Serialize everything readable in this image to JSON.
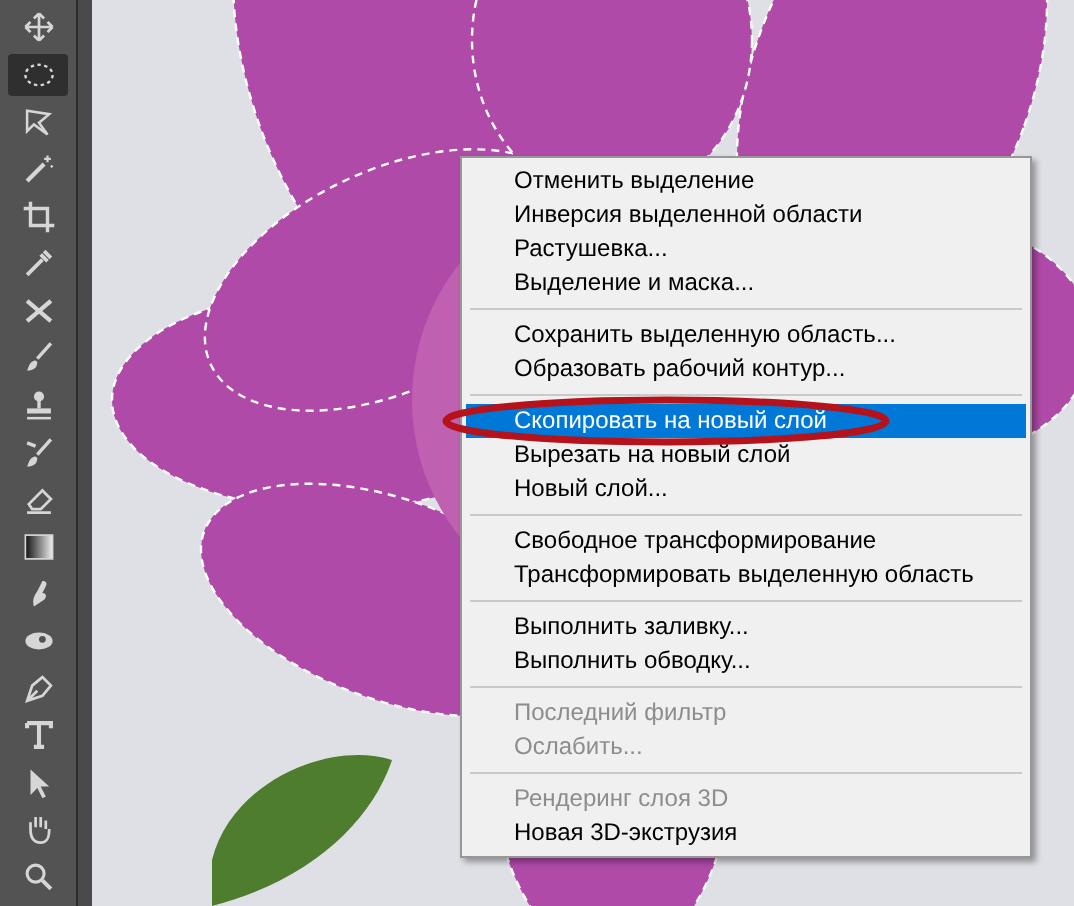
{
  "toolbar": {
    "tools": [
      {
        "selected": false
      },
      {
        "selected": true
      },
      {
        "selected": false
      },
      {
        "selected": false
      },
      {
        "selected": false
      },
      {
        "selected": false
      },
      {
        "selected": false
      },
      {
        "selected": false
      },
      {
        "selected": false
      },
      {
        "selected": false
      },
      {
        "selected": false
      },
      {
        "selected": false
      },
      {
        "selected": false
      },
      {
        "selected": false
      },
      {
        "selected": false
      },
      {
        "selected": false
      },
      {
        "selected": false
      },
      {
        "selected": false
      },
      {
        "selected": false
      }
    ]
  },
  "context_menu": {
    "groups": [
      {
        "items": [
          {
            "label": "Отменить выделение",
            "disabled": false,
            "selected": false
          },
          {
            "label": "Инверсия выделенной области",
            "disabled": false,
            "selected": false
          },
          {
            "label": "Растушевка...",
            "disabled": false,
            "selected": false
          },
          {
            "label": "Выделение и маска...",
            "disabled": false,
            "selected": false
          }
        ]
      },
      {
        "items": [
          {
            "label": "Сохранить выделенную область...",
            "disabled": false,
            "selected": false
          },
          {
            "label": "Образовать рабочий контур...",
            "disabled": false,
            "selected": false
          }
        ]
      },
      {
        "items": [
          {
            "label": "Скопировать на новый слой",
            "disabled": false,
            "selected": true
          },
          {
            "label": "Вырезать на новый слой",
            "disabled": false,
            "selected": false
          },
          {
            "label": "Новый слой...",
            "disabled": false,
            "selected": false
          }
        ]
      },
      {
        "items": [
          {
            "label": "Свободное трансформирование",
            "disabled": false,
            "selected": false
          },
          {
            "label": "Трансформировать выделенную область",
            "disabled": false,
            "selected": false
          }
        ]
      },
      {
        "items": [
          {
            "label": "Выполнить заливку...",
            "disabled": false,
            "selected": false
          },
          {
            "label": "Выполнить обводку...",
            "disabled": false,
            "selected": false
          }
        ]
      },
      {
        "items": [
          {
            "label": "Последний фильтр",
            "disabled": true,
            "selected": false
          },
          {
            "label": "Ослабить...",
            "disabled": true,
            "selected": false
          }
        ]
      },
      {
        "items": [
          {
            "label": "Рендеринг слоя 3D",
            "disabled": true,
            "selected": false
          },
          {
            "label": "Новая 3D-экструзия",
            "disabled": false,
            "selected": false
          }
        ]
      }
    ]
  }
}
